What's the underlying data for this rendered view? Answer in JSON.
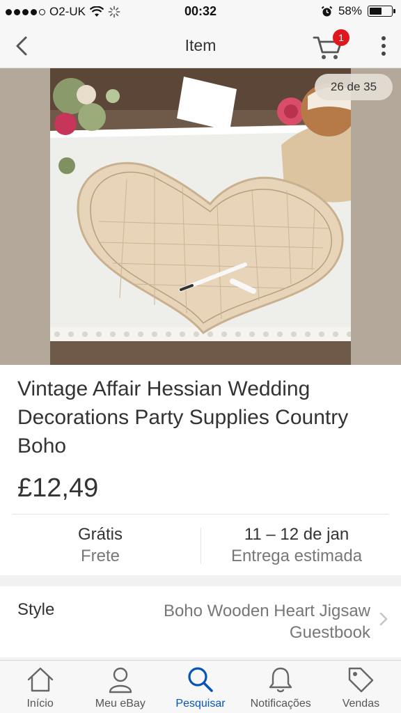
{
  "status_bar": {
    "carrier": "O2-UK",
    "time": "00:32",
    "battery": "58%",
    "battery_level": 0.58
  },
  "nav": {
    "title": "Item",
    "cart_count": "1",
    "icons": [
      "chevron-left-icon",
      "cart-icon",
      "more-vertical-icon"
    ]
  },
  "gallery": {
    "counter": "26 de 35"
  },
  "item": {
    "title": "Vintage Affair Hessian Wedding Decorations Party Supplies Country Boho",
    "price": "£12,49"
  },
  "shipping": {
    "cost": "Grátis",
    "cost_label": "Frete",
    "delivery": "11 – 12 de jan",
    "delivery_label": "Entrega estimada"
  },
  "style": {
    "label": "Style",
    "value": "Boho Wooden Heart Jigsaw Guestbook"
  },
  "tabs": [
    {
      "label": "Início",
      "icon": "home-icon"
    },
    {
      "label": "Meu eBay",
      "icon": "user-icon"
    },
    {
      "label": "Pesquisar",
      "icon": "search-icon"
    },
    {
      "label": "Notificações",
      "icon": "bell-icon"
    },
    {
      "label": "Vendas",
      "icon": "tag-icon"
    }
  ],
  "colors": {
    "accent": "#0654ba",
    "badge": "#e0171c"
  }
}
